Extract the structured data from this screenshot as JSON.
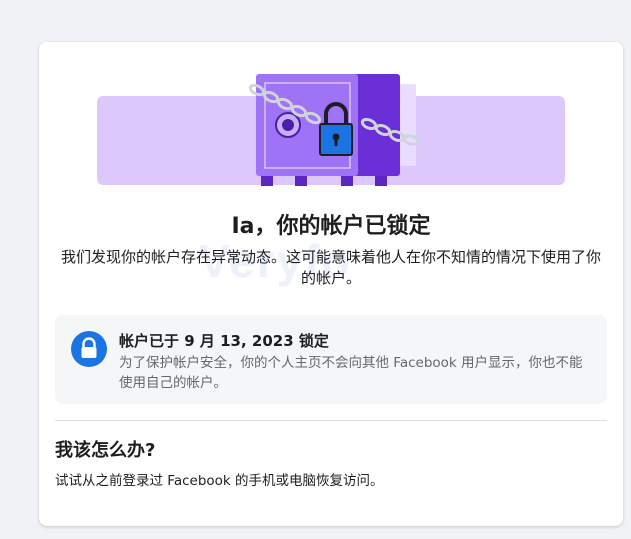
{
  "page": {
    "title": "Ia，你的帐户已锁定",
    "subtitle": "我们发现你的帐户存在异常动态。这可能意味着他人在你不知情的情况下使用了你的帐户。"
  },
  "watermark": "Veryfo",
  "notice": {
    "icon": "lock-icon",
    "title": "帐户已于 9 月 13, 2023 锁定",
    "description": "为了保护帐户安全，你的个人主页不会向其他 Facebook 用户显示，你也不能使用自己的帐户。"
  },
  "help": {
    "heading": "我该怎么办?",
    "text": "试试从之前登录过 Facebook 的手机或电脑恢复访问。"
  },
  "colors": {
    "background": "#f0f2f5",
    "illustration_band": "#dcc8fb",
    "safe_body": "#9f73f6",
    "safe_side": "#6b2fd8",
    "lock_blue": "#1b74e4"
  }
}
